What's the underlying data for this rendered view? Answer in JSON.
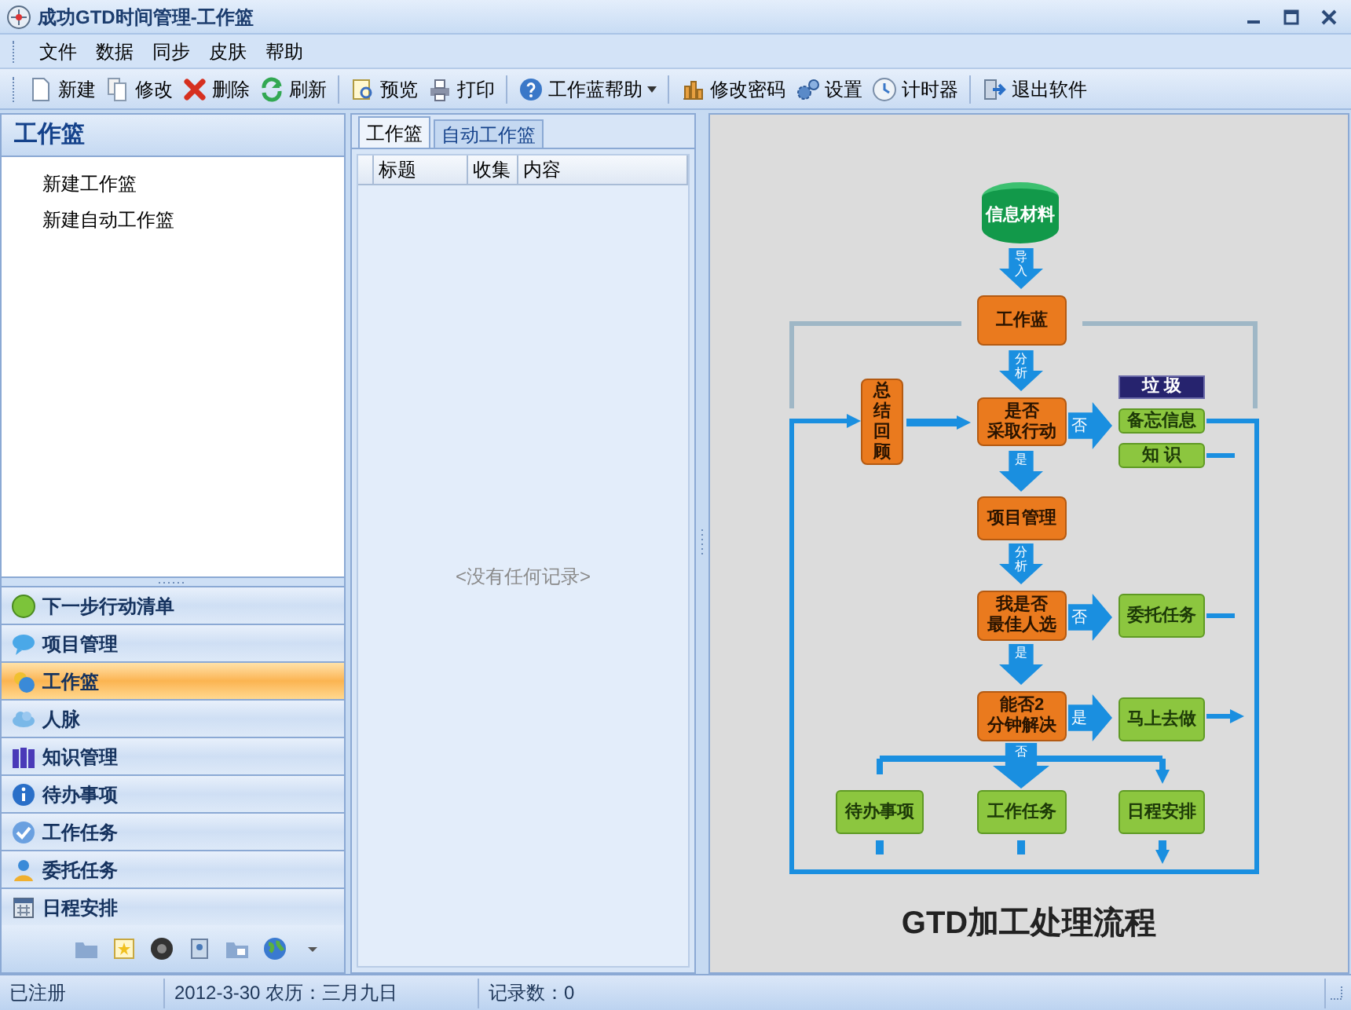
{
  "window": {
    "title": "成功GTD时间管理-工作篮"
  },
  "menu": [
    "文件",
    "数据",
    "同步",
    "皮肤",
    "帮助"
  ],
  "toolbar": [
    [
      {
        "label": "新建",
        "has_menu": false
      },
      {
        "label": "修改",
        "has_menu": false
      },
      {
        "label": "删除",
        "has_menu": false
      },
      {
        "label": "刷新",
        "has_menu": false
      }
    ],
    [
      {
        "label": "预览",
        "has_menu": false
      },
      {
        "label": "打印",
        "has_menu": false
      }
    ],
    [
      {
        "label": "工作蓝帮助",
        "has_menu": true
      }
    ],
    [
      {
        "label": "修改密码",
        "has_menu": false
      },
      {
        "label": "设置",
        "has_menu": false
      },
      {
        "label": "计时器",
        "has_menu": false
      }
    ],
    [
      {
        "label": "退出软件",
        "has_menu": false
      }
    ]
  ],
  "sidebar": {
    "title": "工作篮",
    "tree": [
      "新建工作篮",
      "新建自动工作篮"
    ],
    "items": [
      {
        "label": "下一步行动清单",
        "selected": false
      },
      {
        "label": "项目管理",
        "selected": false
      },
      {
        "label": "工作篮",
        "selected": true
      },
      {
        "label": "人脉",
        "selected": false
      },
      {
        "label": "知识管理",
        "selected": false
      },
      {
        "label": "待办事项",
        "selected": false
      },
      {
        "label": "工作任务",
        "selected": false
      },
      {
        "label": "委托任务",
        "selected": false
      },
      {
        "label": "日程安排",
        "selected": false
      }
    ]
  },
  "tabs": [
    {
      "label": "工作篮",
      "selected": true
    },
    {
      "label": "自动工作篮",
      "selected": false
    }
  ],
  "table": {
    "columns": [
      "标题",
      "收集",
      "内容"
    ],
    "empty_text": "<没有任何记录>"
  },
  "diagram": {
    "title": "GTD加工处理流程",
    "nodes": [
      {
        "lines": [
          "信息材料"
        ],
        "kind": "cylinder"
      },
      {
        "lines": [
          "工作蓝"
        ],
        "kind": "process"
      },
      {
        "lines": [
          "总结回顾"
        ],
        "kind": "vertical"
      },
      {
        "lines": [
          "是否",
          "采取行动"
        ],
        "kind": "process"
      },
      {
        "lines": [
          "垃 圾"
        ],
        "kind": "dark"
      },
      {
        "lines": [
          "备忘信息"
        ],
        "kind": "result"
      },
      {
        "lines": [
          "知 识"
        ],
        "kind": "result"
      },
      {
        "lines": [
          "项目管理"
        ],
        "kind": "process"
      },
      {
        "lines": [
          "我是否",
          "最佳人选"
        ],
        "kind": "process"
      },
      {
        "lines": [
          "委托任务"
        ],
        "kind": "result"
      },
      {
        "lines": [
          "能否2",
          "分钟解决"
        ],
        "kind": "process"
      },
      {
        "lines": [
          "马上去做"
        ],
        "kind": "result"
      },
      {
        "lines": [
          "待办事项"
        ],
        "kind": "result"
      },
      {
        "lines": [
          "工作任务"
        ],
        "kind": "result"
      },
      {
        "lines": [
          "日程安排"
        ],
        "kind": "result"
      }
    ],
    "arrows": [
      {
        "label": "导入",
        "kind": "down"
      },
      {
        "label": "分析",
        "kind": "down"
      },
      {
        "label": "否",
        "kind": "right"
      },
      {
        "label": "是",
        "kind": "down"
      },
      {
        "label": "分析",
        "kind": "down"
      },
      {
        "label": "否",
        "kind": "right"
      },
      {
        "label": "是",
        "kind": "down"
      },
      {
        "label": "是",
        "kind": "right"
      },
      {
        "label": "否",
        "kind": "down"
      }
    ]
  },
  "status_bar": [
    "已注册",
    "2012-3-30 农历：三月九日",
    "记录数：0"
  ]
}
